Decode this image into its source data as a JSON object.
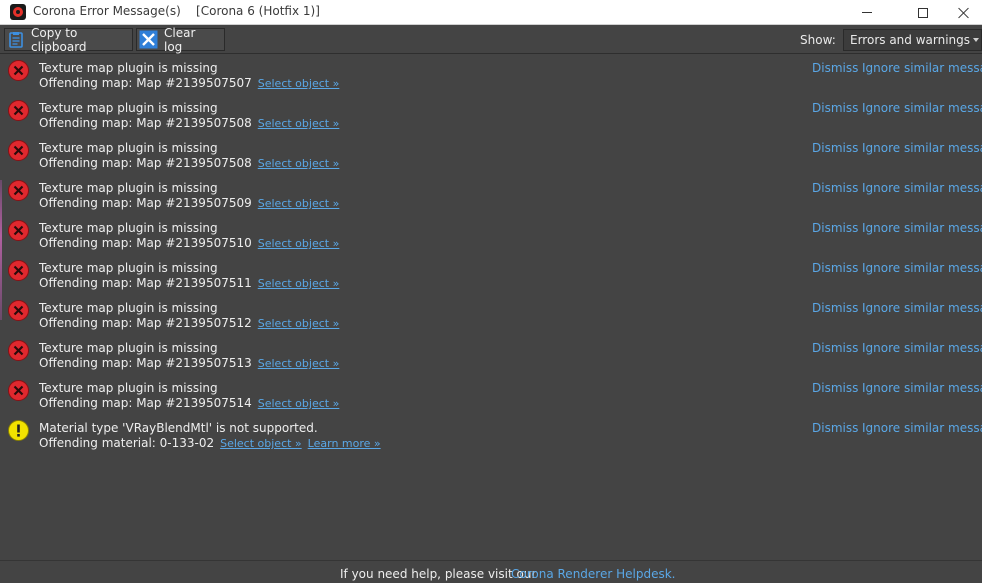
{
  "window": {
    "title": "Corona Error Message(s)    [Corona 6 (Hotfix 1)]"
  },
  "toolbar": {
    "copy_label": "Copy to clipboard",
    "clear_label": "Clear log",
    "show_label": "Show:",
    "show_value": "Errors and warnings"
  },
  "messages": [
    {
      "type": "error",
      "title": "Texture map plugin is missing",
      "detail": "Offending map: Map #2139507507",
      "link": "Select object »",
      "dismiss": "Dismiss",
      "ignore": "Ignore similar messages"
    },
    {
      "type": "error",
      "title": "Texture map plugin is missing",
      "detail": "Offending map: Map #2139507508",
      "link": "Select object »",
      "dismiss": "Dismiss",
      "ignore": "Ignore similar messages"
    },
    {
      "type": "error",
      "title": "Texture map plugin is missing",
      "detail": "Offending map: Map #2139507508",
      "link": "Select object »",
      "dismiss": "Dismiss",
      "ignore": "Ignore similar messages"
    },
    {
      "type": "error",
      "title": "Texture map plugin is missing",
      "detail": "Offending map: Map #2139507509",
      "link": "Select object »",
      "dismiss": "Dismiss",
      "ignore": "Ignore similar messages"
    },
    {
      "type": "error",
      "title": "Texture map plugin is missing",
      "detail": "Offending map: Map #2139507510",
      "link": "Select object »",
      "dismiss": "Dismiss",
      "ignore": "Ignore similar messages"
    },
    {
      "type": "error",
      "title": "Texture map plugin is missing",
      "detail": "Offending map: Map #2139507511",
      "link": "Select object »",
      "dismiss": "Dismiss",
      "ignore": "Ignore similar messages"
    },
    {
      "type": "error",
      "title": "Texture map plugin is missing",
      "detail": "Offending map: Map #2139507512",
      "link": "Select object »",
      "dismiss": "Dismiss",
      "ignore": "Ignore similar messages"
    },
    {
      "type": "error",
      "title": "Texture map plugin is missing",
      "detail": "Offending map: Map #2139507513",
      "link": "Select object »",
      "dismiss": "Dismiss",
      "ignore": "Ignore similar messages"
    },
    {
      "type": "error",
      "title": "Texture map plugin is missing",
      "detail": "Offending map: Map #2139507514",
      "link": "Select object »",
      "dismiss": "Dismiss",
      "ignore": "Ignore similar messages"
    },
    {
      "type": "warning",
      "title": "Material type 'VRayBlendMtl' is not supported.",
      "detail": "Offending material: 0-133-02",
      "link": "Select object »",
      "link2": "Learn more »",
      "dismiss": "Dismiss",
      "ignore": "Ignore similar messages"
    }
  ],
  "footer": {
    "text": "If you need help, please visit our",
    "link": "Corona Renderer Helpdesk."
  },
  "colors": {
    "background": "#444444",
    "link": "#5aa7e6",
    "error": "#e0282e",
    "warning": "#f2e200"
  }
}
